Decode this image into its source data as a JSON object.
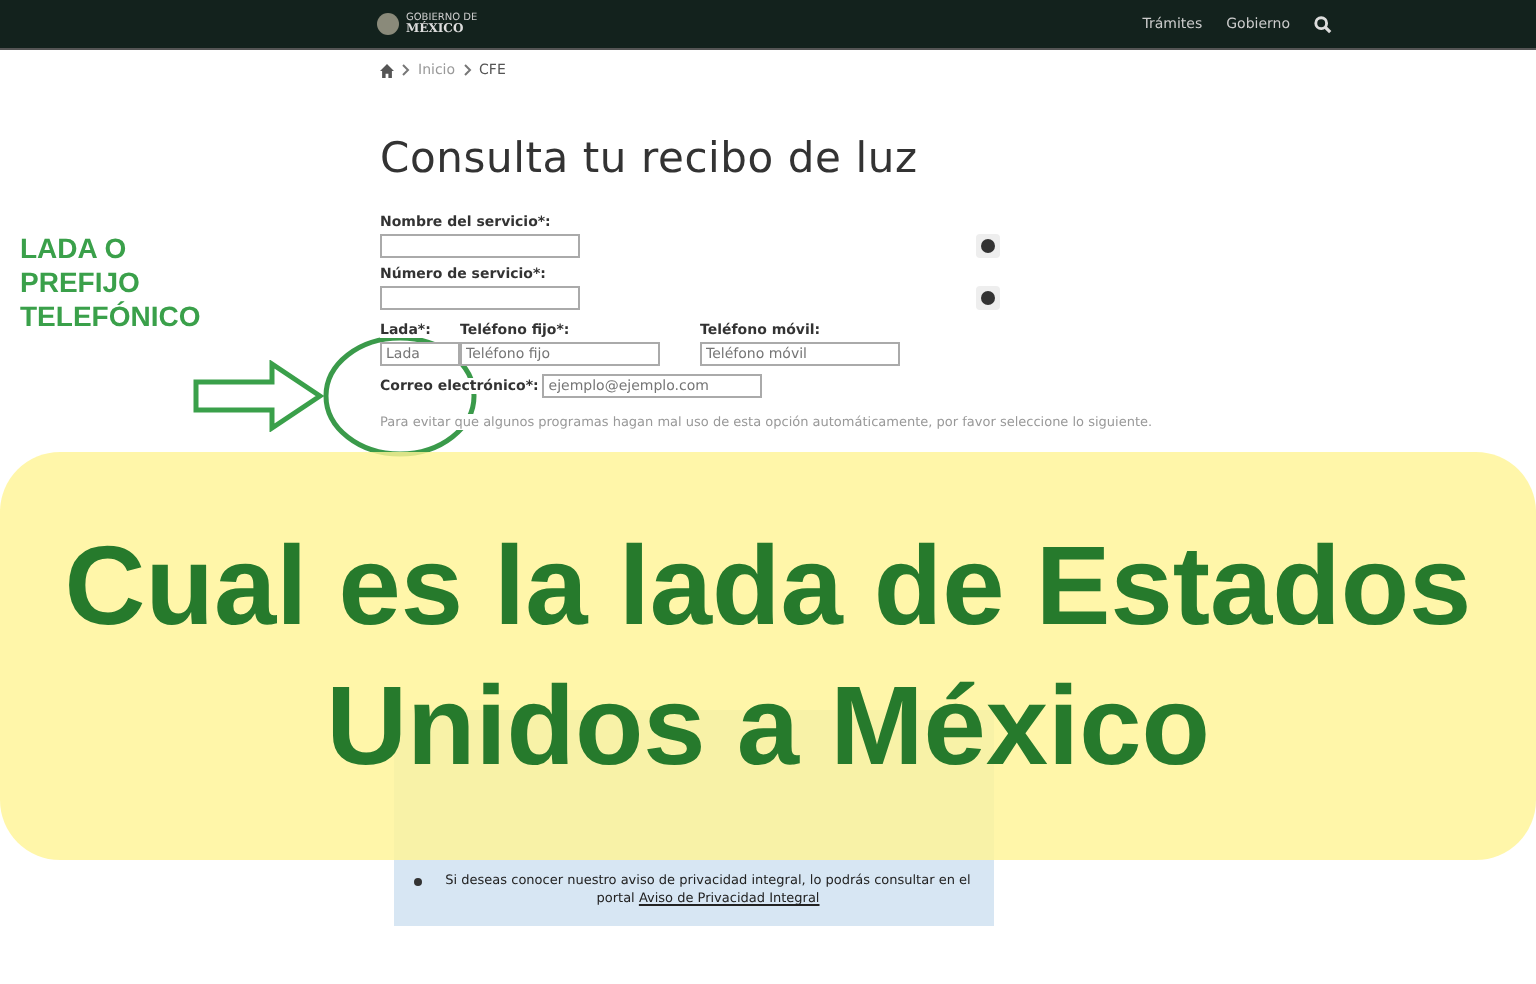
{
  "header": {
    "logo_small": "GOBIERNO DE",
    "logo": "MÉXICO",
    "nav": [
      "Trámites",
      "Gobierno"
    ]
  },
  "breadcrumb": [
    "Inicio",
    "CFE"
  ],
  "page_title": "Consulta tu recibo de luz",
  "form": {
    "fields": [
      {
        "label": "Nombre del servicio*:",
        "kind": "help"
      },
      {
        "label": "Número de servicio*:",
        "kind": "help"
      }
    ],
    "phone_fields": [
      {
        "label": "Lada*:",
        "placeholder": "Lada",
        "kind": "short"
      },
      {
        "label": "Teléfono fijo*:",
        "placeholder": "Teléfono fijo",
        "kind": "wide"
      },
      {
        "label": "Teléfono móvil:",
        "placeholder": "Teléfono móvil",
        "kind": "wide"
      }
    ],
    "email": {
      "label": "Correo electrónico*:",
      "placeholder": "ejemplo@ejemplo.com"
    },
    "captcha_note": "Para evitar que algunos programas hagan mal uso de esta opción automáticamente, por favor seleccione lo siguiente."
  },
  "privacy": {
    "text": "Si deseas conocer nuestro aviso de privacidad integral, lo podrás consultar en el portal",
    "link": "Aviso de Privacidad Integral"
  },
  "annotation": {
    "label": "LADA O PREFIJO TELEFÓNICO"
  },
  "banner": {
    "title": "Cual es la lada de Estados Unidos a México"
  }
}
